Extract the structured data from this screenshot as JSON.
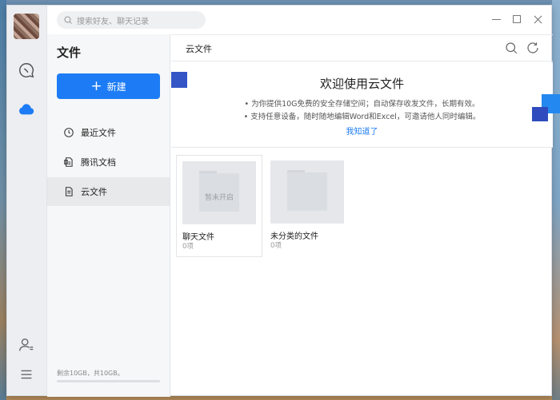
{
  "search": {
    "placeholder": "搜索好友、聊天记录"
  },
  "window_controls": {
    "maximize": "☐",
    "minimize": "—",
    "close": "✕"
  },
  "rail": {
    "icons": [
      "avatar",
      "chat-icon",
      "cloud-icon",
      "contacts-icon",
      "menu-icon"
    ]
  },
  "sidebar": {
    "title": "文件",
    "new_button": "新建",
    "items": [
      {
        "label": "最近文件",
        "icon": "clock-icon"
      },
      {
        "label": "腾讯文档",
        "icon": "doc-icon"
      },
      {
        "label": "云文件",
        "icon": "file-icon"
      }
    ],
    "quota_text": "剩余10GB，共10GB。",
    "quota_used_fraction": 0.0
  },
  "main": {
    "title": "云文件",
    "banner": {
      "title": "欢迎使用云文件",
      "line1": "• 为你提供10G免费的安全存储空间；自动保存收发文件，长期有效。",
      "line2": "• 支持任意设备，随时随地编辑Word和Excel，可邀请他人同时编辑。",
      "link": "我知道了"
    },
    "cards": [
      {
        "name": "聊天文件",
        "count": "0项",
        "thumb_text": "暂未开启"
      },
      {
        "name": "未分类的文件",
        "count": "0项",
        "thumb_text": ""
      }
    ]
  },
  "colors": {
    "accent": "#1d7cf5",
    "deco_blue": "#2389f0",
    "deco_dark": "#3455c6"
  }
}
